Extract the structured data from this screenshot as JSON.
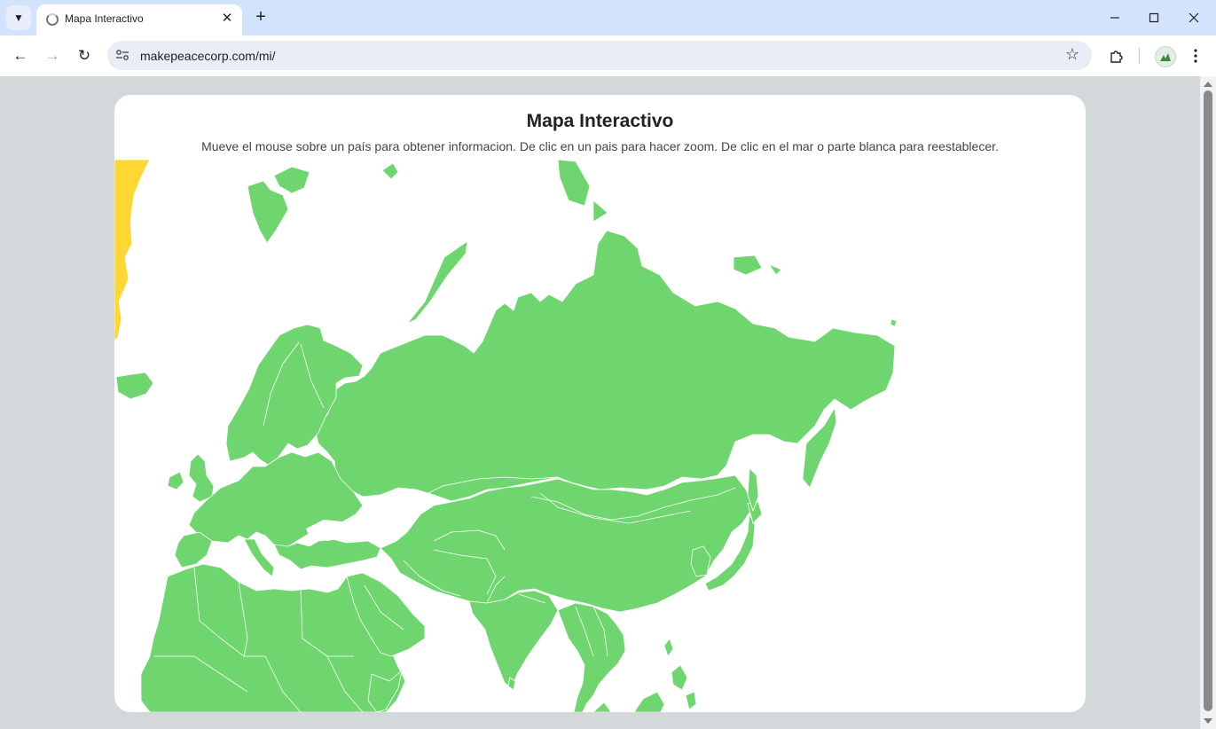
{
  "browser": {
    "tab_title": "Mapa Interactivo",
    "url": "makepeacecorp.com/mi/"
  },
  "page": {
    "title": "Mapa Interactivo",
    "subtitle": "Mueve el mouse sobre un país para obtener informacion. De clic en un pais para hacer zoom. De clic en el mar o parte blanca para reestablecer."
  },
  "map": {
    "land_color": "#6fd66f",
    "highlight_color": "#fdd835",
    "border_color": "#ffffff"
  }
}
